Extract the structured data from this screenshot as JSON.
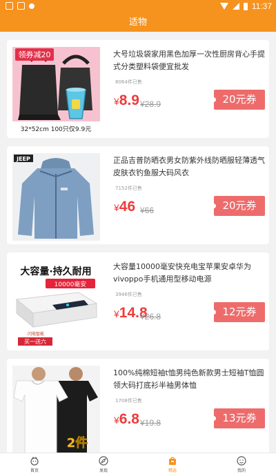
{
  "status_bar": {
    "time": "11:37"
  },
  "app_bar": {
    "title": "适物"
  },
  "products": [
    {
      "title": "大号垃圾袋家用黑色加厚一次性厨房背心手提式分类塑料袋便宜批发",
      "sold": "8064件已售",
      "currency": "¥",
      "price": "8.9",
      "original_price": "¥28.9",
      "coupon": "20元券",
      "image": {
        "badge": "领券减20",
        "caption": "32*52cm 100只仅9.9元"
      }
    },
    {
      "title": "正品吉普防晒衣男女防紫外线防晒服轻薄透气皮肤衣钓鱼服大码风衣",
      "sold": "7152件已售",
      "currency": "¥",
      "price": "46",
      "original_price": "¥66",
      "coupon": "20元券",
      "image": {
        "brand": "JEEP"
      }
    },
    {
      "title": "大容量10000毫安快充电宝苹果安卓华为vivoppo手机通用型移动电源",
      "sold": "3946件已售",
      "currency": "¥",
      "price": "14.8",
      "original_price": "¥26.8",
      "coupon": "12元券",
      "image": {
        "headline": "大容量·持久耐用",
        "capacity": "10000毫安",
        "promo": "买一送六",
        "brand": "闪电智能"
      }
    },
    {
      "title": "100%纯棉短袖t恤男纯色新款男士短袖T恤圆领大码打底衫半袖男体恤",
      "sold": "1708件已售",
      "currency": "¥",
      "price": "6.8",
      "original_price": "¥19.8",
      "coupon": "13元券",
      "image": {
        "tag": "2件"
      }
    }
  ],
  "tab_bar": {
    "items": [
      {
        "label": "首页",
        "icon": "home-icon"
      },
      {
        "label": "发现",
        "icon": "compass-icon"
      },
      {
        "label": "精选",
        "icon": "shopping-bag-icon",
        "active": true
      },
      {
        "label": "我的",
        "icon": "user-icon"
      }
    ]
  },
  "colors": {
    "accent": "#f6921e",
    "price": "#ef3b3b",
    "coupon": "#ee6b6b"
  }
}
